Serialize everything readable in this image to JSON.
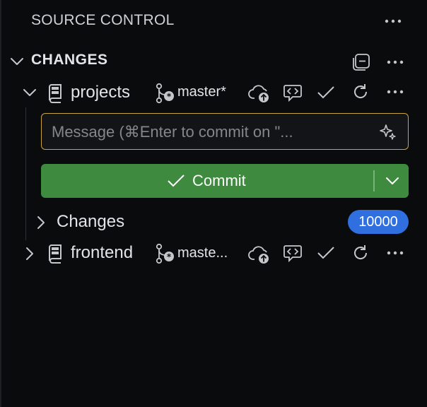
{
  "header": {
    "title": "SOURCE CONTROL",
    "more_icon": "ellipsis-icon"
  },
  "section": {
    "title": "CHANGES"
  },
  "repos": [
    {
      "name": "projects",
      "branch": "master*",
      "expanded": true,
      "message_placeholder": "Message (⌘Enter to commit on \"...",
      "commit_label": "Commit",
      "changes_group": {
        "label": "Changes",
        "count": "10000"
      }
    },
    {
      "name": "frontend",
      "branch": "maste...",
      "expanded": false
    }
  ],
  "colors": {
    "background": "#0a0b0d",
    "commit_button": "#3e8a3f",
    "badge": "#2f6fe0",
    "input_focus_border": "#c8a53a"
  }
}
